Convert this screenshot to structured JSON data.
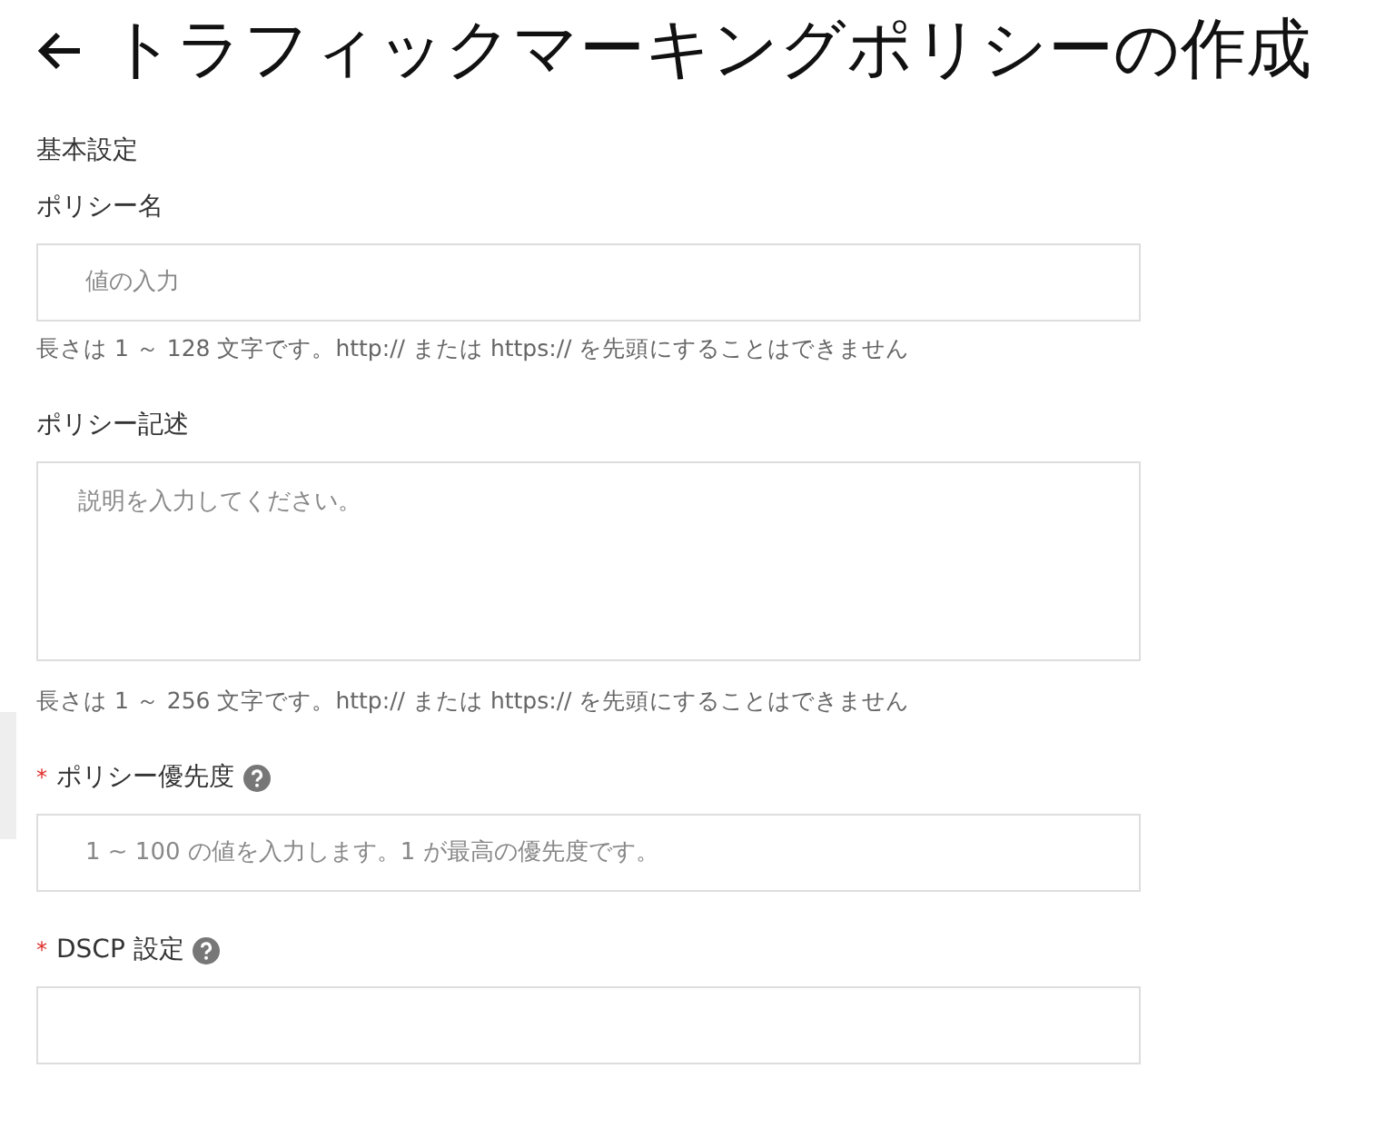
{
  "title": "トラフィックマーキングポリシーの作成",
  "section": "基本設定",
  "fields": [
    {
      "kind": "input",
      "label": "ポリシー名",
      "placeholder": "値の入力",
      "hint": "長さは 1 ～ 128 文字です。http:// または https:// を先頭にすることはできません"
    },
    {
      "kind": "textarea",
      "label": "ポリシー記述",
      "placeholder": "説明を入力してください。",
      "hint": "長さは 1 ～ 256 文字です。http:// または https:// を先頭にすることはできません"
    },
    {
      "kind": "input",
      "required_mark": "*",
      "label": "ポリシー優先度",
      "help": true,
      "placeholder": "1 ~ 100 の値を入力します。1 が最高の優先度です。"
    },
    {
      "kind": "input",
      "required_mark": "*",
      "label": "DSCP 設定",
      "help": true
    }
  ]
}
